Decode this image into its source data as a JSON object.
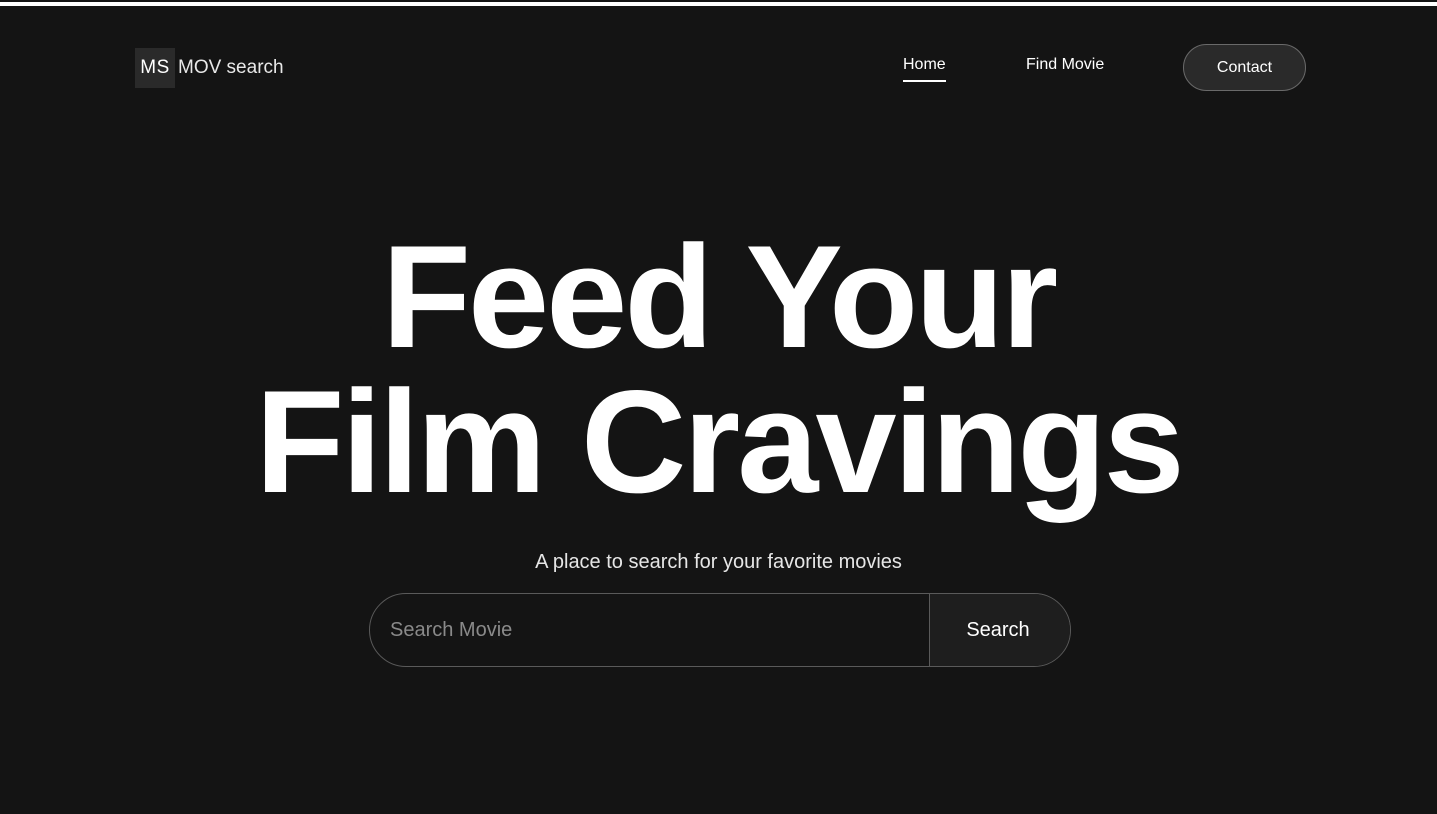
{
  "header": {
    "logo_mark": "MS",
    "logo_text": "MOV search",
    "nav": [
      {
        "label": "Home",
        "active": true
      },
      {
        "label": "Find Movie",
        "active": false
      }
    ],
    "contact_label": "Contact"
  },
  "hero": {
    "title_line1": "Feed Your",
    "title_line2": "Film Cravings",
    "subtitle": "A place to search for your favorite movies"
  },
  "search": {
    "placeholder": "Search Movie",
    "value": "",
    "button_label": "Search"
  },
  "colors": {
    "background": "#141414",
    "text": "#ffffff",
    "button_bg": "#2a2a2a",
    "border": "#5a5a5a"
  }
}
